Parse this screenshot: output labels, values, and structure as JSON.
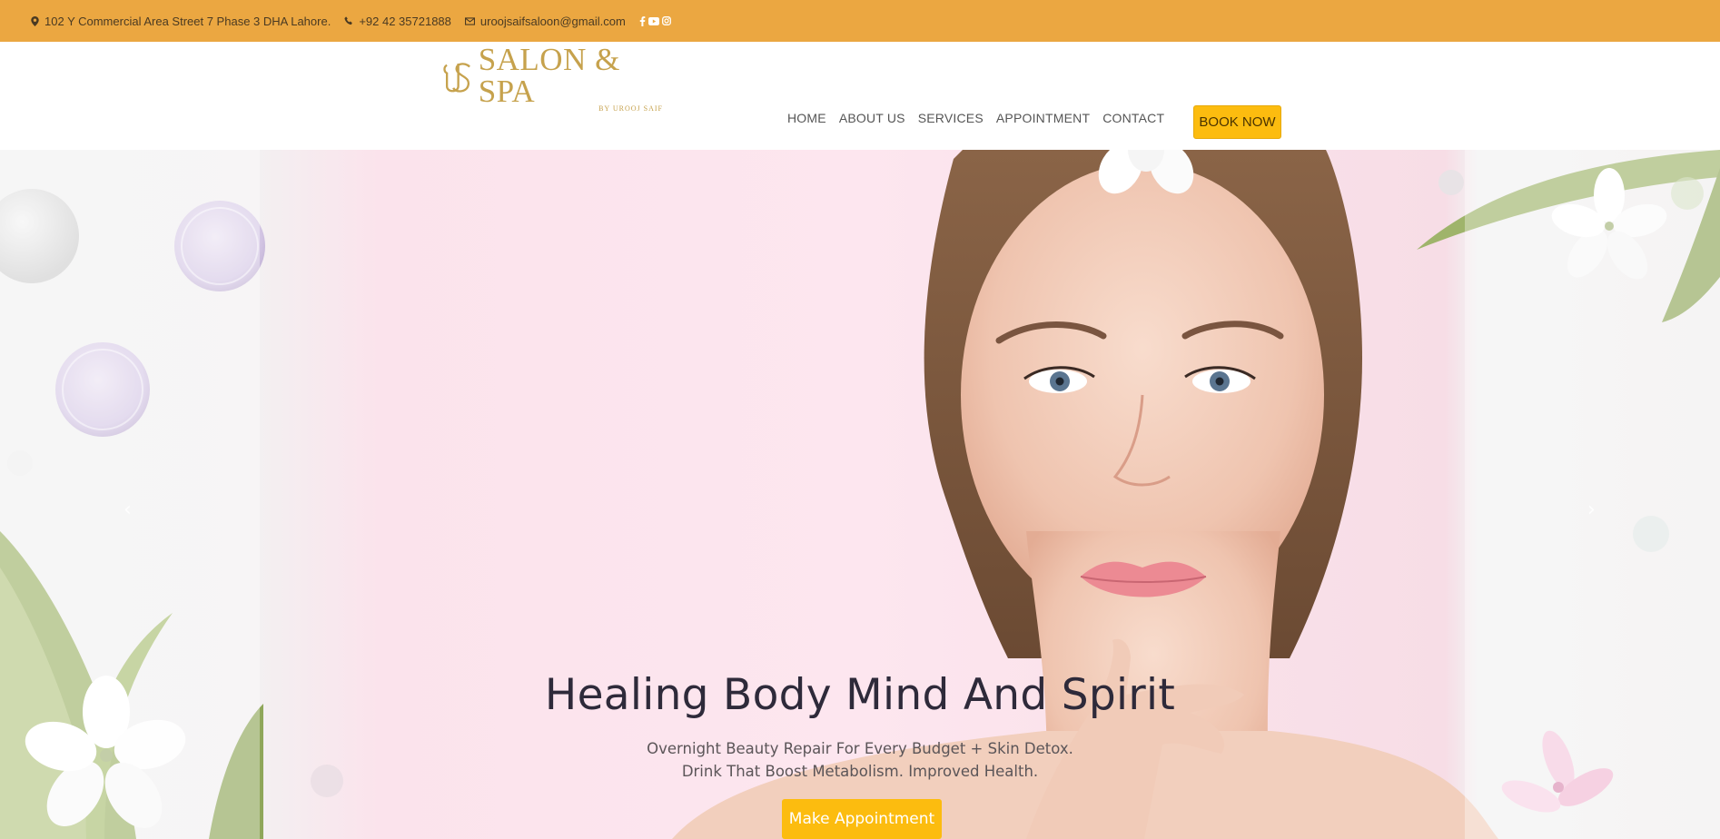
{
  "topbar": {
    "address": "102 Y Commercial Area Street 7 Phase 3 DHA Lahore.",
    "phone": "+92 42 35721888",
    "email": "uroojsaifsaloon@gmail.com",
    "socials": [
      "facebook-icon",
      "youtube-icon",
      "instagram-icon"
    ],
    "background": "#eba741"
  },
  "logo": {
    "mark": "US",
    "title": "SALON & SPA",
    "subtitle": "BY UROOJ SAIF",
    "color": "#c6a24d"
  },
  "nav": {
    "items": [
      "HOME",
      "ABOUT US",
      "SERVICES",
      "APPOINTMENT",
      "CONTACT"
    ]
  },
  "book_button": {
    "label": "BOOK NOW",
    "color": "#fcbc0f"
  },
  "hero": {
    "title": "Healing Body Mind And Spirit",
    "subtitle_line1": "Overnight Beauty Repair For Every Budget + Skin Detox.",
    "subtitle_line2": "Drink That Boost Metabolism. Improved Health.",
    "cta_label": "Make Appointment",
    "prev_arrow": "‹",
    "next_arrow": "›"
  }
}
